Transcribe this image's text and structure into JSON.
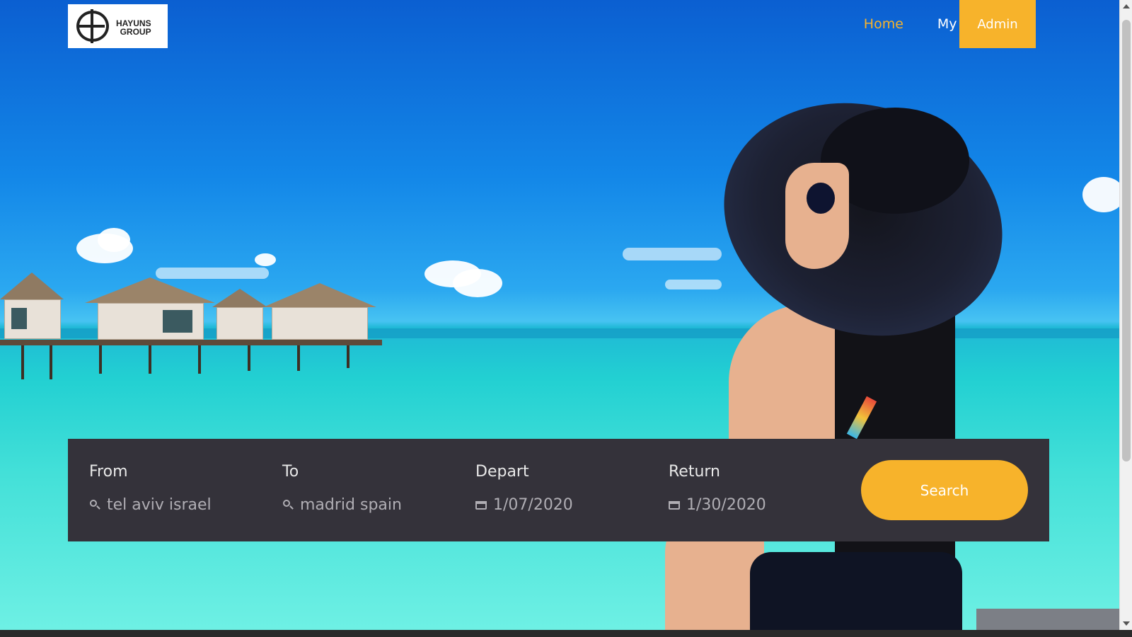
{
  "brand": {
    "logo_line1": "HAYUNS",
    "logo_line2": "GROUP"
  },
  "nav": {
    "items": [
      {
        "label": "Home",
        "active": true
      },
      {
        "label": "My favorite",
        "active": false
      }
    ],
    "admin_label": "Admin"
  },
  "search": {
    "fields": [
      {
        "label": "From",
        "value": "tel aviv israel",
        "icon": "search-icon"
      },
      {
        "label": "To",
        "value": "madrid spain",
        "icon": "search-icon"
      },
      {
        "label": "Depart",
        "value": "1/07/2020",
        "icon": "calendar-icon"
      },
      {
        "label": "Return",
        "value": "1/30/2020",
        "icon": "calendar-icon"
      }
    ],
    "button_label": "Search"
  },
  "colors": {
    "accent": "#f7b32b",
    "panel": "#34323a"
  }
}
